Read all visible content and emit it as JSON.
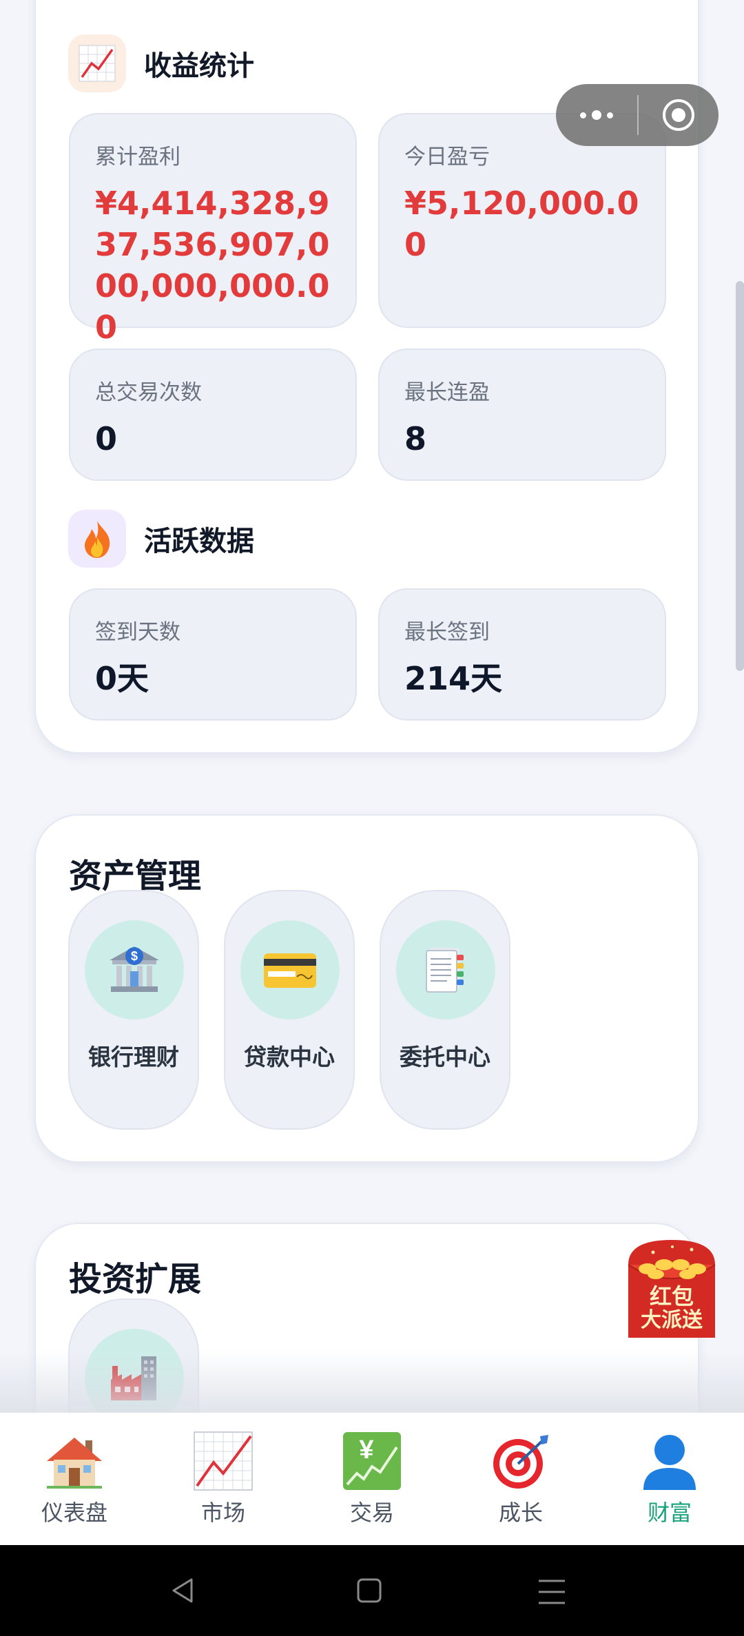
{
  "profit_section": {
    "title": "收益统计",
    "icon": "chart-up-icon",
    "stats": [
      {
        "label": "累计盈利",
        "value": "¥4,414,328,937,536,907,000,000,000.00",
        "color": "#e23b3b"
      },
      {
        "label": "今日盈亏",
        "value": "¥5,120,000.00",
        "color": "#e23b3b"
      },
      {
        "label": "总交易次数",
        "value": "0"
      },
      {
        "label": "最长连盈",
        "value": "8"
      }
    ]
  },
  "activity_section": {
    "title": "活跃数据",
    "icon": "fire-icon",
    "stats": [
      {
        "label": "签到天数",
        "value": "0天"
      },
      {
        "label": "最长签到",
        "value": "214天"
      }
    ]
  },
  "asset_management": {
    "title": "资产管理",
    "items": [
      {
        "label": "银行理财",
        "icon": "bank-icon"
      },
      {
        "label": "贷款中心",
        "icon": "credit-card-icon"
      },
      {
        "label": "委托中心",
        "icon": "notebook-icon"
      }
    ]
  },
  "investment_extension": {
    "title": "投资扩展",
    "items": [
      {
        "icon": "factory-icon"
      }
    ]
  },
  "promo": {
    "line1": "红包",
    "line2": "大派送"
  },
  "tabs": [
    {
      "label": "仪表盘",
      "icon": "house-icon"
    },
    {
      "label": "市场",
      "icon": "chart-icon"
    },
    {
      "label": "交易",
      "icon": "yen-chart-icon"
    },
    {
      "label": "成长",
      "icon": "target-icon"
    },
    {
      "label": "财富",
      "icon": "user-icon",
      "active": true
    }
  ],
  "colors": {
    "accent": "#1aa37a",
    "profit_red": "#e23b3b"
  }
}
